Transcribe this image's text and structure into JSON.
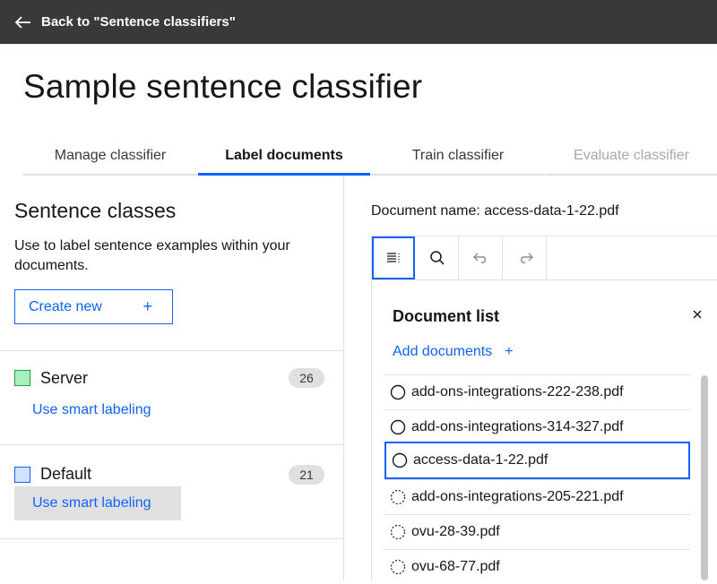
{
  "topbar": {
    "back_label": "Back to \"Sentence classifiers\""
  },
  "page": {
    "title": "Sample sentence classifier"
  },
  "tabs": [
    {
      "label": "Manage classifier"
    },
    {
      "label": "Label documents"
    },
    {
      "label": "Train classifier"
    },
    {
      "label": "Evaluate classifier"
    }
  ],
  "sentence_classes": {
    "title": "Sentence classes",
    "description": "Use to label sentence examples within your documents.",
    "create_label": "Create new",
    "items": [
      {
        "name": "Server",
        "count": "26",
        "color": "#a7f0ba",
        "border": "#24a148",
        "smart": "Use smart labeling"
      },
      {
        "name": "Default",
        "count": "21",
        "color": "#d0e2ff",
        "border": "#0f62fe",
        "smart": "Use smart labeling"
      }
    ]
  },
  "document": {
    "name_label": "Document name: access-data-1-22.pdf"
  },
  "document_list": {
    "title": "Document list",
    "add_label": "Add documents",
    "items": [
      {
        "name": "add-ons-integrations-222-238.pdf"
      },
      {
        "name": "add-ons-integrations-314-327.pdf"
      },
      {
        "name": "access-data-1-22.pdf"
      },
      {
        "name": "add-ons-integrations-205-221.pdf"
      },
      {
        "name": "ovu-28-39.pdf"
      },
      {
        "name": "ovu-68-77.pdf"
      }
    ]
  },
  "colors": {
    "accent": "#0f62fe",
    "topbar": "#393939"
  }
}
